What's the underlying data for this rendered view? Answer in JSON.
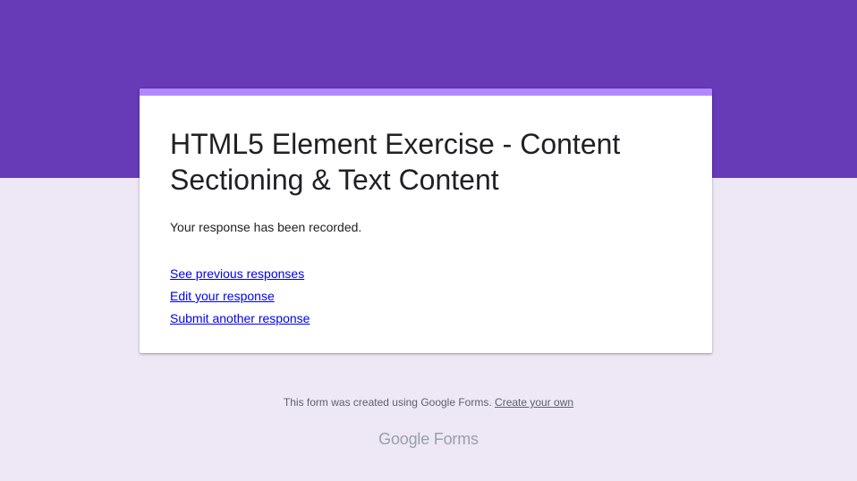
{
  "form": {
    "title": "HTML5 Element Exercise - Content Sectioning & Text Content",
    "confirmation": "Your response has been recorded."
  },
  "links": {
    "see_previous": "See previous responses",
    "edit": "Edit your response",
    "submit_another": "Submit another response"
  },
  "footer": {
    "text": "This form was created using Google Forms.",
    "create_link": "Create your own"
  },
  "branding": {
    "logo_text": "Google Forms"
  },
  "colors": {
    "header_band": "#673ab7",
    "background": "#ede7f6",
    "card_accent": "#b388ff",
    "link": "#0000ee"
  }
}
